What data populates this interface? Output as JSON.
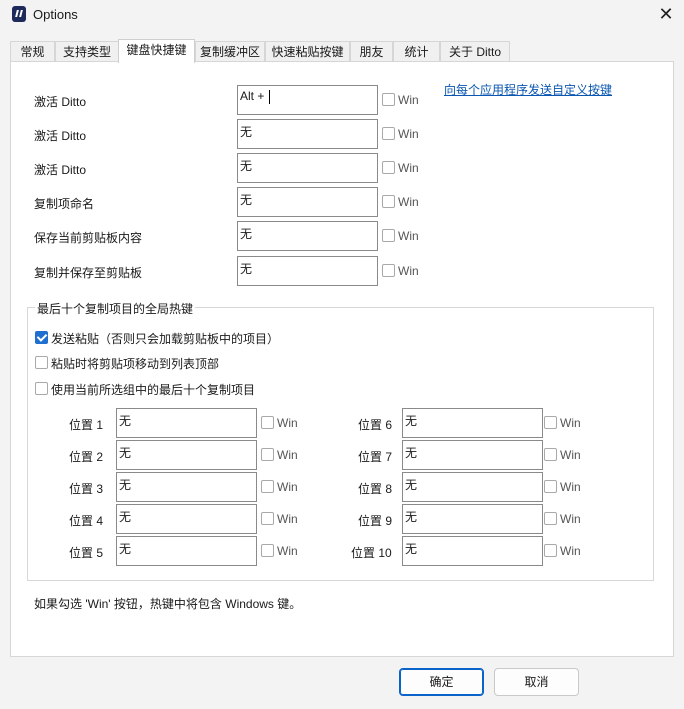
{
  "window": {
    "title": "Options",
    "close_glyph": "✕"
  },
  "tabs": [
    {
      "label": "常规",
      "active": false
    },
    {
      "label": "支持类型",
      "active": false
    },
    {
      "label": "键盘快捷键",
      "active": true
    },
    {
      "label": "复制缓冲区",
      "active": false
    },
    {
      "label": "快速粘贴按键",
      "active": false
    },
    {
      "label": "朋友",
      "active": false
    },
    {
      "label": "统计",
      "active": false
    },
    {
      "label": "关于 Ditto",
      "active": false
    }
  ],
  "hotkeys": [
    {
      "label": "激活 Ditto",
      "value": "Alt + ",
      "win_label": "Win",
      "win_checked": false
    },
    {
      "label": "激活 Ditto",
      "value": "无",
      "win_label": "Win",
      "win_checked": false
    },
    {
      "label": "激活 Ditto",
      "value": "无",
      "win_label": "Win",
      "win_checked": false
    },
    {
      "label": "复制项命名",
      "value": "无",
      "win_label": "Win",
      "win_checked": false
    },
    {
      "label": "保存当前剪贴板内容",
      "value": "无",
      "win_label": "Win",
      "win_checked": false
    },
    {
      "label": "复制并保存至剪贴板",
      "value": "无",
      "win_label": "Win",
      "win_checked": false
    }
  ],
  "custom_keys_link": "向每个应用程序发送自定义按键",
  "last_ten_group": {
    "title": "最后十个复制项目的全局热键",
    "options": [
      {
        "label": "发送粘贴（否则只会加载剪贴板中的项目）",
        "checked": true
      },
      {
        "label": "粘贴时将剪贴项移动到列表顶部",
        "checked": false
      },
      {
        "label": "使用当前所选组中的最后十个复制项目",
        "checked": false
      }
    ],
    "positions_left": [
      {
        "label": "位置 1",
        "value": "无",
        "win_label": "Win"
      },
      {
        "label": "位置 2",
        "value": "无",
        "win_label": "Win"
      },
      {
        "label": "位置 3",
        "value": "无",
        "win_label": "Win"
      },
      {
        "label": "位置 4",
        "value": "无",
        "win_label": "Win"
      },
      {
        "label": "位置 5",
        "value": "无",
        "win_label": "Win"
      }
    ],
    "positions_right": [
      {
        "label": "位置 6",
        "value": "无",
        "win_label": "Win"
      },
      {
        "label": "位置 7",
        "value": "无",
        "win_label": "Win"
      },
      {
        "label": "位置 8",
        "value": "无",
        "win_label": "Win"
      },
      {
        "label": "位置 9",
        "value": "无",
        "win_label": "Win"
      },
      {
        "label": "位置 10",
        "value": "无",
        "win_label": "Win"
      }
    ]
  },
  "footer_note": "如果勾选 'Win' 按钮，热键中将包含 Windows 键。",
  "buttons": {
    "ok": "确定",
    "cancel": "取消"
  },
  "colors": {
    "accent": "#1f6fd0",
    "link": "#0a56b0"
  }
}
